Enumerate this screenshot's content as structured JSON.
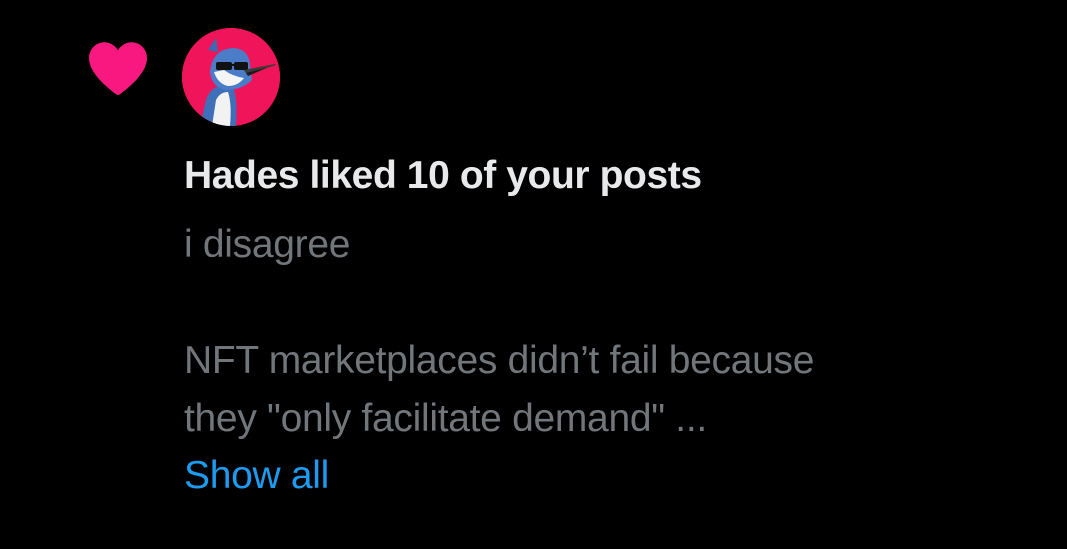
{
  "notification": {
    "icon": "heart-icon",
    "icon_color": "#f91880",
    "avatar_bg_color": "#f0145a",
    "title": "Hades liked 10 of your posts",
    "post_lines": [
      "i disagree",
      "",
      "NFT marketplaces didn’t fail because",
      "they \"only facilitate demand\" ..."
    ],
    "show_all_label": "Show all",
    "link_color": "#1d9bf0"
  }
}
